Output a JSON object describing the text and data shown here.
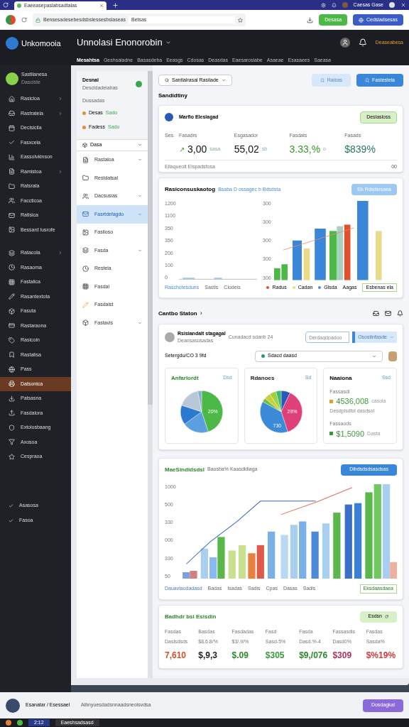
{
  "browser": {
    "tab_title": "Eaeeasepaslabsadtalas",
    "address": "Bensesadesebesdsbslessesbslaseas",
    "search": "Betsas",
    "profile_name": "Caesas Gase",
    "green_button": "Desasa",
    "blue_button": "Cedsladsesas"
  },
  "header": {
    "logo": "Unkomooia",
    "title": "Unnolasi Enonorobin",
    "link": "Deaseabesa"
  },
  "nav": [
    {
      "label": "Mesahtsa",
      "selected": true
    },
    {
      "label": "Geshsaladne",
      "selected": false
    },
    {
      "label": "Basasdeba",
      "selected": false
    },
    {
      "label": "Eeasgs",
      "selected": false
    },
    {
      "label": "Cdosas",
      "selected": false
    },
    {
      "label": "Deasdas",
      "selected": false
    },
    {
      "label": "Eaesarosiabe",
      "selected": false
    },
    {
      "label": "Asaeae",
      "selected": false
    },
    {
      "label": "Esasaees",
      "selected": false
    },
    {
      "label": "Saeasa",
      "selected": false
    }
  ],
  "user": {
    "name": "Sastilanesa",
    "role": "Dasciste"
  },
  "sidebar": [
    {
      "label": "Rasicloa",
      "chevron": true,
      "selected": false
    },
    {
      "label": "Rastratela",
      "chevron": true,
      "selected": false
    },
    {
      "label": "Decisicila",
      "chevron": false,
      "selected": false
    },
    {
      "label": "Fasxcela",
      "chevron": false,
      "selected": false
    },
    {
      "label": "Eassolvkinson",
      "chevron": false,
      "selected": false
    },
    {
      "label": "Ramistoa",
      "chevron": true,
      "selected": false
    },
    {
      "label": "Ratsrata",
      "chevron": false,
      "selected": false
    },
    {
      "label": "Faccticoa",
      "chevron": false,
      "selected": false
    },
    {
      "label": "Ratisica",
      "chevron": false,
      "selected": false
    },
    {
      "label": "Bessard lusrofe",
      "chevron": false,
      "selected": false
    },
    {
      "label": "Ratacola",
      "chevron": true,
      "selected": false
    },
    {
      "label": "Rasaoma",
      "chevron": false,
      "selected": false
    },
    {
      "label": "Fastalica",
      "chevron": false,
      "selected": false
    },
    {
      "label": "Rasantextota",
      "chevron": false,
      "selected": false
    },
    {
      "label": "Fasuta",
      "chevron": false,
      "selected": false
    },
    {
      "label": "Rastaraona",
      "chevron": false,
      "selected": false
    },
    {
      "label": "Rasicoin",
      "chevron": false,
      "selected": false
    },
    {
      "label": "Rastalisa",
      "chevron": false,
      "selected": false
    },
    {
      "label": "Pass",
      "chevron": false,
      "selected": false
    },
    {
      "label": "Datsonica",
      "chevron": false,
      "selected": true
    },
    {
      "label": "Patsasna",
      "chevron": false,
      "selected": false
    },
    {
      "label": "Fasdalora",
      "chevron": false,
      "selected": false
    },
    {
      "label": "Extolosbaang",
      "chevron": false,
      "selected": false
    },
    {
      "label": "Axosoa",
      "chevron": false,
      "selected": false
    },
    {
      "label": "Cespraoa",
      "chevron": false,
      "selected": false
    }
  ],
  "sidebar_checks": [
    {
      "label": "Asasosa",
      "checked": true
    },
    {
      "label": "Fasoa",
      "checked": true
    }
  ],
  "panel": {
    "title": "Desnal",
    "subtitle": "Descidadeiahas",
    "section": "Dussadas",
    "statuses": [
      {
        "label": "Desas",
        "tag": "Sado"
      },
      {
        "label": "Fadess",
        "tag": "Sado"
      }
    ],
    "dropdown": "Dasa",
    "items": [
      {
        "label": "Rastaloa",
        "chevron": true,
        "selected": false
      },
      {
        "label": "Restdatsal",
        "chevron": false,
        "selected": false
      },
      {
        "label": "Dacsusias",
        "chevron": true,
        "selected": false
      },
      {
        "label": "Fasrtdefagdo",
        "chevron": true,
        "selected": true
      },
      {
        "label": "Fasiloso",
        "chevron": false,
        "selected": false
      },
      {
        "label": "Fasda",
        "chevron": true,
        "selected": false
      },
      {
        "label": "Resteia",
        "chevron": false,
        "selected": false
      },
      {
        "label": "Fasdal",
        "chevron": false,
        "selected": false
      },
      {
        "label": "Fasdaist",
        "chevron": false,
        "selected": false
      },
      {
        "label": "Fastavis",
        "chevron": true,
        "selected": false
      }
    ]
  },
  "toolbar": {
    "dropdown": "Santialrasal Rasilade",
    "light_button": "Raisas",
    "primary_button": "Fasteslela"
  },
  "summary": {
    "heading": "Sandidtiny",
    "title": "Marfio Eleslagad",
    "badge": "Deslasloss",
    "prefix": "Ses.",
    "arrow": "↗",
    "stats": [
      {
        "label": "Fasadrs",
        "value": "3,00",
        "note": "sasa",
        "color": "#111111"
      },
      {
        "label": "Esgasador",
        "value": "55,02",
        "note": "sb",
        "color": "#111111"
      },
      {
        "label": "Fasdats",
        "value": "3.33,%",
        "note": "o",
        "color": "#3a9a2a"
      },
      {
        "label": "Fasads",
        "value": "$839%",
        "color": "#2a7a5a"
      }
    ],
    "footer": "Eilaqueolt Eispadsfosa",
    "footer_value": "00"
  },
  "chart1": {
    "title": "Rasiconsuskaotog",
    "links": "Bsaba D ossagec b Bdsdsta",
    "button": "Eb Rdsdsrsaea",
    "left_ticks": [
      "1200",
      "1100",
      "350",
      "350",
      "200",
      "100",
      "0"
    ],
    "right_ticks": [
      "300",
      "300",
      "300",
      "300",
      "300"
    ],
    "x_labels": [
      "Raschotesduns",
      "Sastis",
      "Clodeis"
    ],
    "legend": [
      {
        "label": "Radus",
        "color": "#e0502a"
      },
      {
        "label": "Cadan",
        "color": "#e8dc8a"
      },
      {
        "label": "Glsda",
        "color": "#4a90d9"
      },
      {
        "label": "Aagas"
      }
    ],
    "tag": "Esbenas ela"
  },
  "section": {
    "heading": "Cantbo Staton",
    "arrow": "›"
  },
  "filters": {
    "name": "Rsisiandalt stagagal",
    "sub": "Deansasusadas",
    "note": "Cunadacd sdanb 24",
    "search_placeholder": "Derdagdpadoo",
    "dropdown": "Osostinfasde",
    "caption": "Setergdu/CO 3 9fd",
    "select": "Sdacd daasd"
  },
  "pies": [
    {
      "title": "Anfarlordt",
      "tag": "Dsd",
      "accent": true,
      "labels": [
        "20%"
      ]
    },
    {
      "title": "Rdanoes",
      "tag": "Sd",
      "accent": false,
      "labels": [
        "29%",
        "730"
      ]
    }
  ],
  "totals": {
    "title": "Naaiona",
    "tag": "Ssd",
    "rows": [
      {
        "label": "Fassasdi",
        "value": "4536,008",
        "unit": "casola",
        "color": "#e0a030",
        "sub": "Desdpisdtol dasdsol"
      },
      {
        "label": "Fassaods",
        "value": "$1,5090",
        "unit": "Dasta",
        "color": "#3a9a3a"
      }
    ]
  },
  "chart2": {
    "title": "MaeSindidsdsl",
    "subtitle": "Baosba% Kaasdidiaga",
    "button": "Dibdsdsdsasdsas",
    "ticks": [
      "1000",
      "500",
      "330",
      "000",
      "330",
      "50"
    ],
    "x_labels": [
      "Badas",
      "Isadas",
      "Sadis",
      "Cpas",
      "Dasas",
      "Sadis"
    ],
    "left_tag": "Dauavlaodadasd",
    "right_tag": "Eksdaasdaea"
  },
  "bottom": {
    "title": "Badhdr bsi Esisdin",
    "button": "Esdsn",
    "stats": [
      {
        "label": "Fasdas",
        "sub": "Daslsdsds",
        "value": "7,610",
        "color": "#d0502a"
      },
      {
        "label": "Basdas",
        "sub": "$8,6.8/%",
        "value": "$,9,3",
        "color": "#222222"
      },
      {
        "label": "Fasdadas",
        "sub": "$3/.9/%",
        "value": "$.09",
        "color": "#2a8a2a"
      },
      {
        "label": "Fasd",
        "sub": "Sasd-5%",
        "value": "$305",
        "color": "#3a9a3a"
      },
      {
        "label": "Fasda",
        "sub": "Dasd.%-4",
        "value": "$9,/076",
        "color": "#2a8a2a"
      },
      {
        "label": "Fassasdis",
        "sub": "Dasd0%",
        "value": "$309",
        "color": "#b03060"
      },
      {
        "label": "Fasdas",
        "sub": "Sasda%",
        "value": "$%19%",
        "color": "#d03a3a"
      }
    ]
  },
  "footer": {
    "name": "Esanatar / Esessael",
    "text": "Aibnyuesdadsnnaadsneolsvdsa",
    "button": "Dosdagkal"
  },
  "taskbar": {
    "time": "2:12",
    "window": "Eaeshsadsasd"
  }
}
